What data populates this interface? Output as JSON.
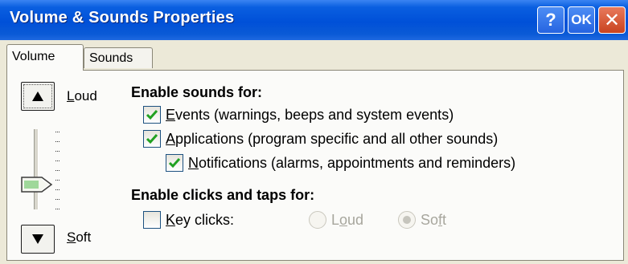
{
  "window": {
    "title": "Volume & Sounds Properties",
    "help_label": "?",
    "ok_label": "OK",
    "close_label": "✕"
  },
  "tabs": [
    {
      "label": "Volume",
      "active": true
    },
    {
      "label": "Sounds",
      "active": false
    }
  ],
  "volume": {
    "loud_prefix": "L",
    "loud_rest": "oud",
    "soft_prefix": "S",
    "soft_rest": "oft",
    "level": 0.2,
    "up_icon": "triangle-up-icon",
    "down_icon": "triangle-down-icon"
  },
  "sounds": {
    "heading": "Enable sounds for:",
    "events": {
      "prefix": "E",
      "rest": "vents (warnings, beeps and system events)",
      "checked": true
    },
    "applications": {
      "prefix": "A",
      "rest": "pplications (program specific and all other sounds)",
      "checked": true
    },
    "notifications": {
      "prefix": "N",
      "rest": "otifications (alarms, appointments and reminders)",
      "checked": true
    }
  },
  "clicks": {
    "heading": "Enable clicks and taps for:",
    "key_clicks": {
      "prefix": "K",
      "rest": "ey clicks:",
      "checked": false
    },
    "loud": {
      "pre": "L",
      "mid": "o",
      "post": "ud",
      "selected": false,
      "disabled": true
    },
    "soft": {
      "pre": "So",
      "mid": "f",
      "post": "t",
      "selected": true,
      "disabled": true
    }
  },
  "colors": {
    "title_bar": "#0050d8",
    "check_green": "#21a121",
    "face": "#ece9d8"
  }
}
